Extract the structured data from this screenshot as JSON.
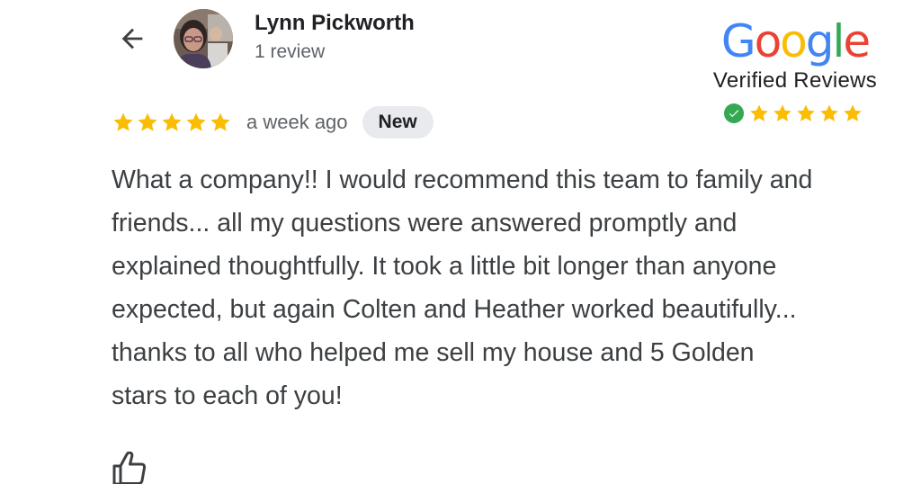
{
  "reviewer": {
    "name": "Lynn Pickworth",
    "review_count": "1 review"
  },
  "review": {
    "rating": 5,
    "time": "a week ago",
    "badge": "New",
    "text": "What a company!! I would recommend this team to family and friends... all my questions were answered promptly and explained thoughtfully. It took a little bit longer than anyone expected, but again Colten and Heather worked beautifully... thanks to all who helped me sell my house and 5 Golden stars to each of you!"
  },
  "google_badge": {
    "logo_letters": [
      "G",
      "o",
      "o",
      "g",
      "l",
      "e"
    ],
    "subtitle": "Verified Reviews",
    "rating": 5
  },
  "colors": {
    "star": "#fbbc04",
    "text": "#3c4043",
    "secondary": "#5f6368",
    "chip_bg": "#e8eaed",
    "google_blue": "#4285f4",
    "google_red": "#ea4335",
    "google_yellow": "#fbbc05",
    "google_green": "#34a853"
  },
  "icons": {
    "back": "arrow-back-icon",
    "like": "thumb-up-icon",
    "verified": "check-circle-icon",
    "star": "star-icon"
  }
}
